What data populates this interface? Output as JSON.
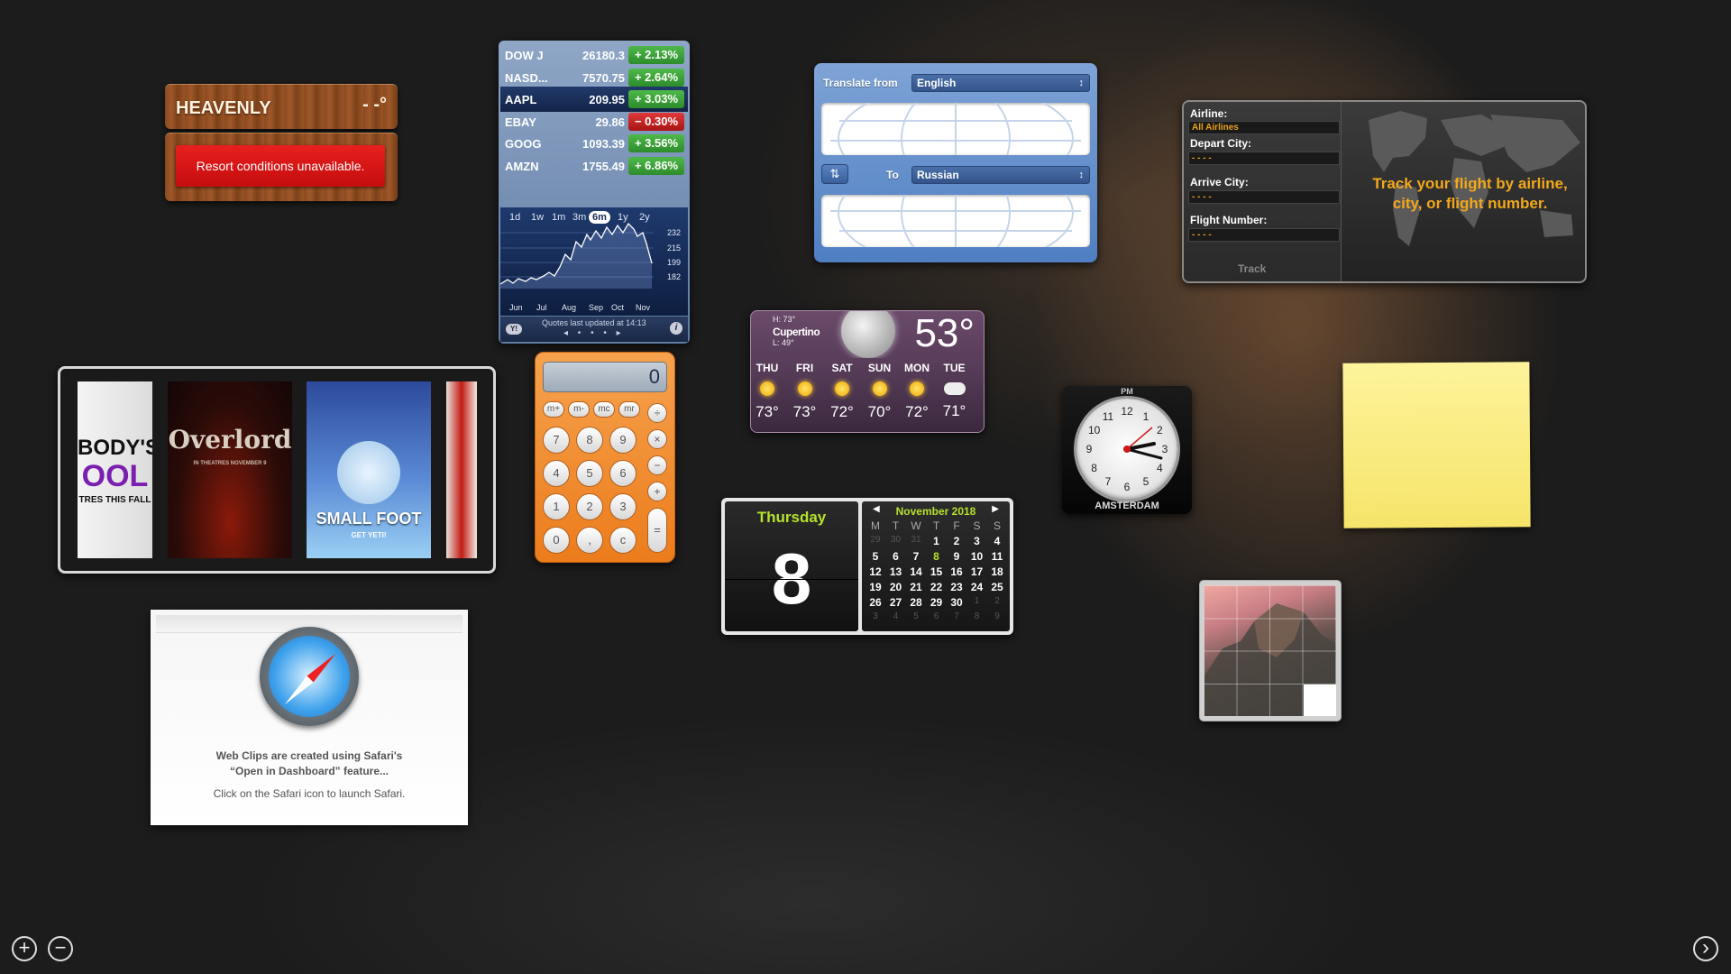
{
  "ski": {
    "name": "HEAVENLY",
    "temp": "- -°",
    "message": "Resort conditions unavailable."
  },
  "stocks": {
    "rows": [
      {
        "symbol": "DOW J",
        "price": "26180.3",
        "change": "+ 2.13%",
        "dir": "up"
      },
      {
        "symbol": "NASD...",
        "price": "7570.75",
        "change": "+ 2.64%",
        "dir": "up"
      },
      {
        "symbol": "AAPL",
        "price": "209.95",
        "change": "+ 3.03%",
        "dir": "up"
      },
      {
        "symbol": "EBAY",
        "price": "29.86",
        "change": "− 0.30%",
        "dir": "down"
      },
      {
        "symbol": "GOOG",
        "price": "1093.39",
        "change": "+ 3.56%",
        "dir": "up"
      },
      {
        "symbol": "AMZN",
        "price": "1755.49",
        "change": "+ 6.86%",
        "dir": "up"
      }
    ],
    "ranges": [
      "1d",
      "1w",
      "1m",
      "3m",
      "6m",
      "1y",
      "2y"
    ],
    "active_range": "6m",
    "y_ticks": [
      "232",
      "215",
      "199",
      "182"
    ],
    "x_ticks": [
      "Jun",
      "Jul",
      "Aug",
      "Sep",
      "Oct",
      "Nov"
    ],
    "updated": "Quotes last updated at 14:13",
    "yahoo_icon": "yahoo-logo-icon",
    "info_icon": "info-icon",
    "colors": {
      "up": "#3aa236",
      "down": "#c82020"
    }
  },
  "translate": {
    "from_label": "Translate from",
    "from_value": "English",
    "to_label": "To",
    "to_value": "Russian",
    "swap_glyph": "⇅"
  },
  "flight": {
    "airline_label": "Airline:",
    "airline_value": "All Airlines",
    "depart_label": "Depart City:",
    "depart_value": "- - - -",
    "arrive_label": "Arrive City:",
    "arrive_value": "- - - -",
    "number_label": "Flight Number:",
    "number_value": "- - - -",
    "track_label": "Track",
    "message_line1": "Track your flight by airline,",
    "message_line2": "city, or flight number.",
    "accent": "#f3a81b"
  },
  "movies": {
    "posters": [
      {
        "line1": "BODY'S",
        "line2": "OOL",
        "line3": "TRES THIS FALL"
      },
      {
        "title": "Overlord",
        "sub": "IN THEATRES NOVEMBER 9"
      },
      {
        "title": "SMALL FOOT",
        "sub": "GET YETI!"
      }
    ]
  },
  "calculator": {
    "display": "0",
    "memory_keys": [
      "m+",
      "m-",
      "mc",
      "mr"
    ],
    "keys": [
      "7",
      "8",
      "9",
      "4",
      "5",
      "6",
      "1",
      "2",
      "3",
      "0",
      ",",
      "c"
    ],
    "ops": [
      "÷",
      "×",
      "−",
      "+"
    ],
    "equals": "="
  },
  "weather": {
    "hi": "H: 73°",
    "lo": "L: 49°",
    "city": "Cupertino",
    "temp": "53°",
    "days": [
      {
        "name": "THU",
        "temp": "73°",
        "icon": "sun-icon"
      },
      {
        "name": "FRI",
        "temp": "73°",
        "icon": "sun-icon"
      },
      {
        "name": "SAT",
        "temp": "72°",
        "icon": "sun-icon"
      },
      {
        "name": "SUN",
        "temp": "70°",
        "icon": "sun-icon"
      },
      {
        "name": "MON",
        "temp": "72°",
        "icon": "sun-icon"
      },
      {
        "name": "TUE",
        "temp": "71°",
        "icon": "cloud-icon"
      }
    ]
  },
  "calendar": {
    "day_name": "Thursday",
    "date": "8",
    "month": "November 2018",
    "headers": [
      "M",
      "T",
      "W",
      "T",
      "F",
      "S",
      "S"
    ],
    "weeks": [
      [
        "29",
        "30",
        "31",
        "1",
        "2",
        "3",
        "4"
      ],
      [
        "5",
        "6",
        "7",
        "8",
        "9",
        "10",
        "11"
      ],
      [
        "12",
        "13",
        "14",
        "15",
        "16",
        "17",
        "18"
      ],
      [
        "19",
        "20",
        "21",
        "22",
        "23",
        "24",
        "25"
      ],
      [
        "26",
        "27",
        "28",
        "29",
        "30",
        "1",
        "2"
      ],
      [
        "3",
        "4",
        "5",
        "6",
        "7",
        "8",
        "9"
      ]
    ],
    "accent": "#b6e22c"
  },
  "clock": {
    "ampm": "PM",
    "city": "AMSTERDAM",
    "numbers": [
      "12",
      "1",
      "2",
      "3",
      "4",
      "5",
      "6",
      "7",
      "8",
      "9",
      "10",
      "11"
    ]
  },
  "webclip": {
    "line1": "Web Clips are created using Safari's",
    "line2": "“Open in Dashboard” feature...",
    "line3": "Click on the Safari icon to launch Safari."
  },
  "controls": {
    "add_glyph": "+",
    "remove_glyph": "−",
    "next_glyph": "›"
  }
}
